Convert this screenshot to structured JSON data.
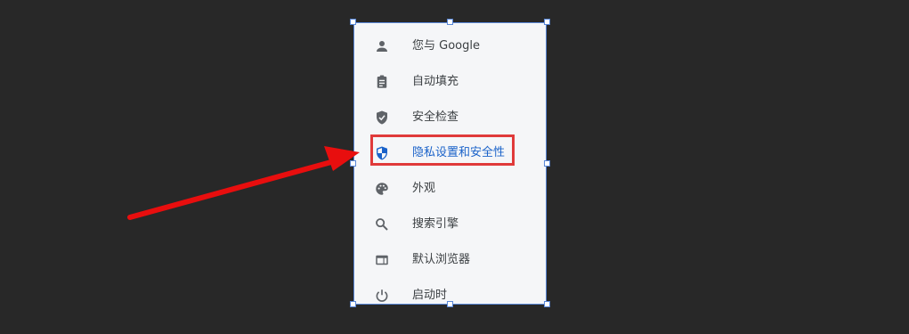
{
  "menu": {
    "items": [
      {
        "label": "您与 Google",
        "icon": "person-icon",
        "active": false
      },
      {
        "label": "自动填充",
        "icon": "clipboard-icon",
        "active": false
      },
      {
        "label": "安全检查",
        "icon": "shield-check-icon",
        "active": false
      },
      {
        "label": "隐私设置和安全性",
        "icon": "shield-privacy-icon",
        "active": true
      },
      {
        "label": "外观",
        "icon": "palette-icon",
        "active": false
      },
      {
        "label": "搜索引擎",
        "icon": "search-icon",
        "active": false
      },
      {
        "label": "默认浏览器",
        "icon": "browser-window-icon",
        "active": false
      },
      {
        "label": "启动时",
        "icon": "power-icon",
        "active": false
      }
    ]
  },
  "colors": {
    "background": "#282828",
    "menu_background": "#f5f6f8",
    "active_text": "#1a62c9",
    "text": "#3c4043",
    "icon": "#5f6368",
    "highlight": "#e03a3a",
    "arrow": "#e80e0e",
    "selection_border": "#5a88d8"
  }
}
